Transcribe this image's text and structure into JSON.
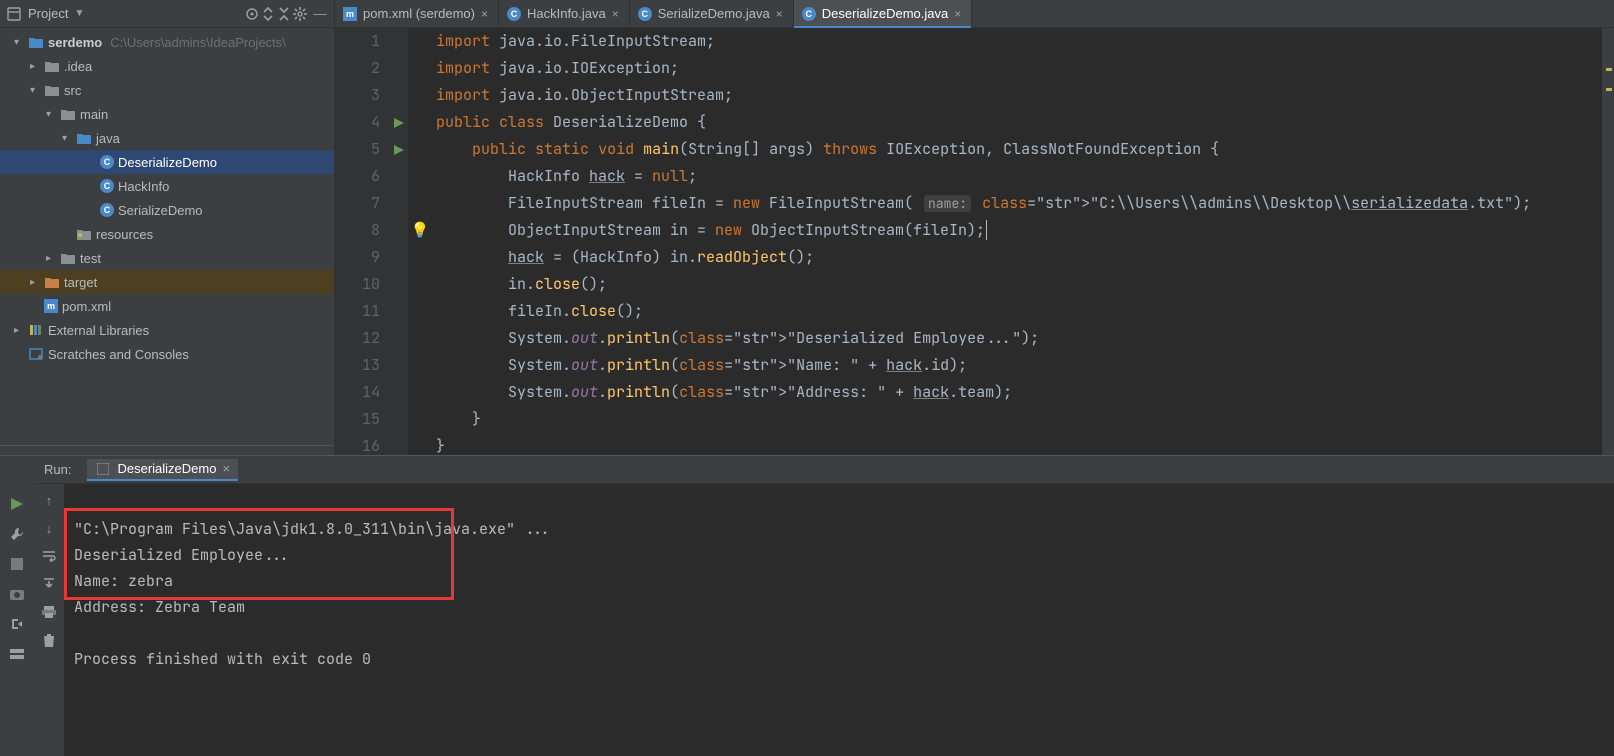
{
  "side": {
    "title": "Project",
    "root": {
      "name": "serdemo",
      "path": "C:\\Users\\admins\\IdeaProjects\\"
    },
    "nodes": {
      "idea": ".idea",
      "src": "src",
      "main": "main",
      "java": "java",
      "classes": [
        "DeserializeDemo",
        "HackInfo",
        "SerializeDemo"
      ],
      "resources": "resources",
      "test": "test",
      "target": "target",
      "pom": "pom.xml",
      "ext": "External Libraries",
      "scratches": "Scratches and Consoles"
    }
  },
  "tabs": [
    {
      "label": "pom.xml (serdemo)",
      "icon": "pom"
    },
    {
      "label": "HackInfo.java",
      "icon": "class"
    },
    {
      "label": "SerializeDemo.java",
      "icon": "class"
    },
    {
      "label": "DeserializeDemo.java",
      "icon": "class",
      "active": true
    }
  ],
  "code": {
    "lines": [
      "import java.io.FileInputStream;",
      "import java.io.IOException;",
      "import java.io.ObjectInputStream;",
      "public class DeserializeDemo {",
      "    public static void main(String[] args) throws IOException, ClassNotFoundException {",
      "        HackInfo hack = null;",
      "        FileInputStream fileIn = new FileInputStream( name: \"C:\\\\Users\\\\admins\\\\Desktop\\\\serializedata.txt\");",
      "        ObjectInputStream in = new ObjectInputStream(fileIn);",
      "        hack = (HackInfo) in.readObject();",
      "        in.close();",
      "        fileIn.close();",
      "        System.out.println(\"Deserialized Employee...\");",
      "        System.out.println(\"Name: \" + hack.id);",
      "        System.out.println(\"Address: \" + hack.team);",
      "    }",
      "}"
    ]
  },
  "run": {
    "label": "Run:",
    "tab": "DeserializeDemo",
    "cmd": "\"C:\\Program Files\\Java\\jdk1.8.0_311\\bin\\java.exe\" ...",
    "out": [
      "Deserialized Employee...",
      "Name: zebra",
      "Address: Zebra Team"
    ],
    "exit": "Process finished with exit code 0"
  }
}
